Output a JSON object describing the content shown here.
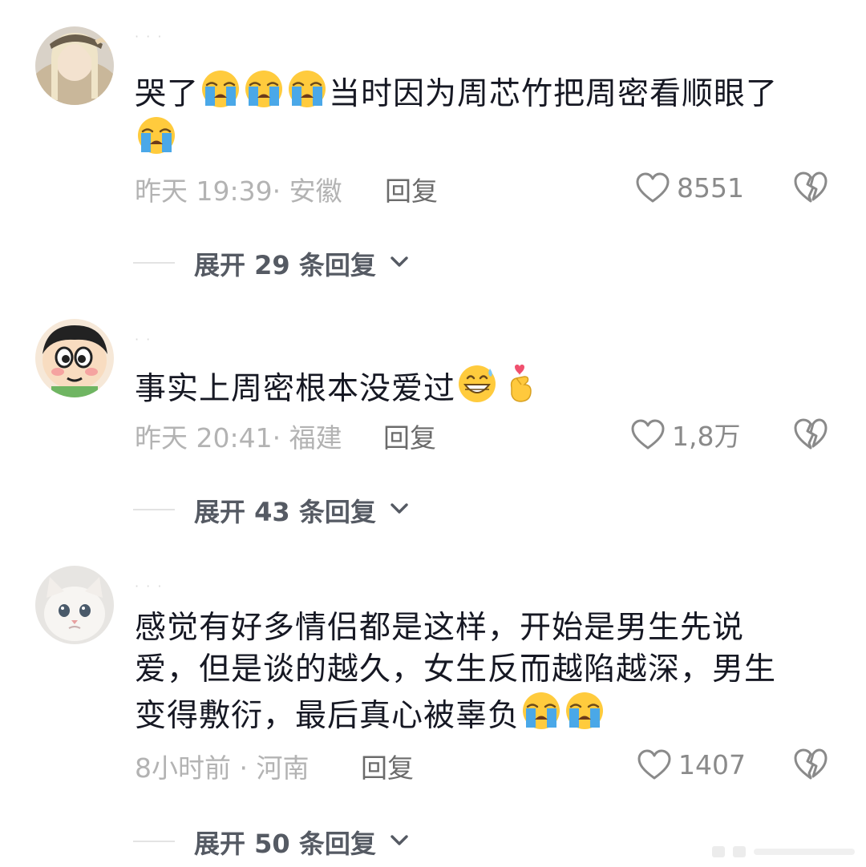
{
  "comments": [
    {
      "username": "· · ·",
      "text_parts": [
        "哭了",
        "",
        "",
        "",
        "当时因为周芯竹把周密看顺眼了",
        ""
      ],
      "time": "昨天 19:39",
      "location": "安徽",
      "reply_label": "回复",
      "likes": "8551",
      "expand_label": "展开 29 条回复"
    },
    {
      "username": "· ·",
      "text": "事实上周密根本没爱过",
      "time": "昨天 20:41",
      "location": "福建",
      "reply_label": "回复",
      "likes": "1,8万",
      "expand_label": "展开 43 条回复"
    },
    {
      "username": "· · ·",
      "text_lines": [
        "感觉有好多情侣都是这样，开始是男生先说",
        "爱，但是谈的越久，女生反而越陷越深，男生",
        "变得敷衍，最后真心被辜负"
      ],
      "time": "8小时前",
      "location": "河南",
      "reply_label": "回复",
      "likes": "1407",
      "expand_label": "展开 50 条回复"
    }
  ],
  "icons": {
    "like": "heart-outline-icon",
    "dislike": "broken-heart-icon",
    "expand": "chevron-down-icon",
    "crying": "loudly-crying-face-emoji",
    "grin_sweat": "grinning-face-with-sweat-emoji",
    "finger_heart": "finger-heart-emoji"
  },
  "colors": {
    "text": "#161823",
    "meta": "#b3b3b3",
    "reply": "#6b6b6b",
    "expand": "#555a63"
  }
}
